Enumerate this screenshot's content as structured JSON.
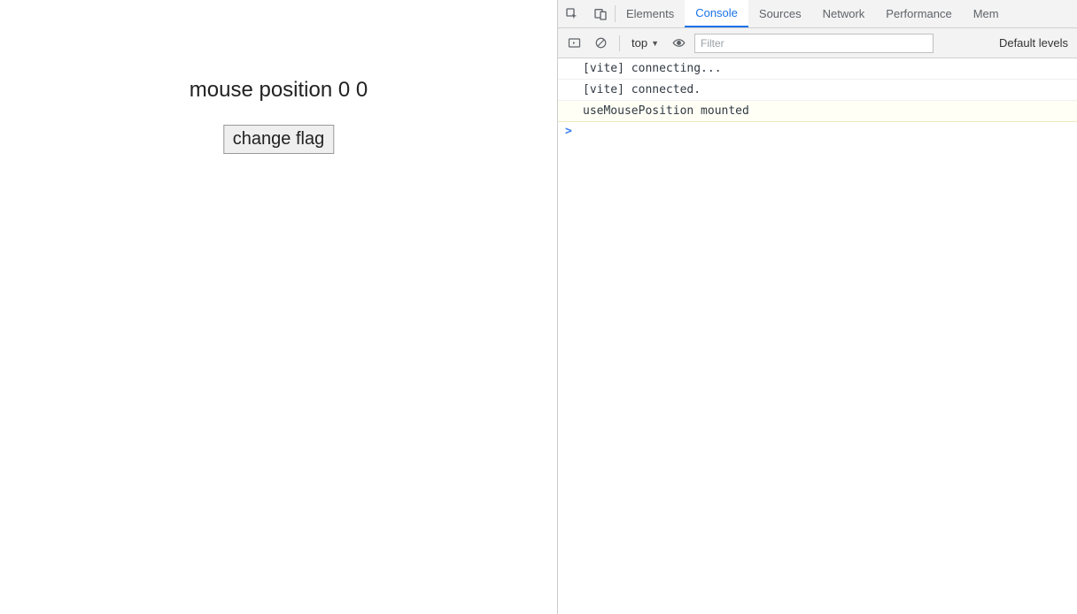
{
  "app": {
    "mouse_label": "mouse position 0 0",
    "button_label": "change flag"
  },
  "devtools": {
    "tabs": {
      "elements": "Elements",
      "console": "Console",
      "sources": "Sources",
      "network": "Network",
      "performance": "Performance",
      "memory": "Mem"
    },
    "toolbar": {
      "context": "top",
      "filter_placeholder": "Filter",
      "levels": "Default levels"
    },
    "logs": [
      "[vite] connecting...",
      "[vite] connected.",
      "useMousePosition mounted"
    ],
    "prompt": ">"
  }
}
